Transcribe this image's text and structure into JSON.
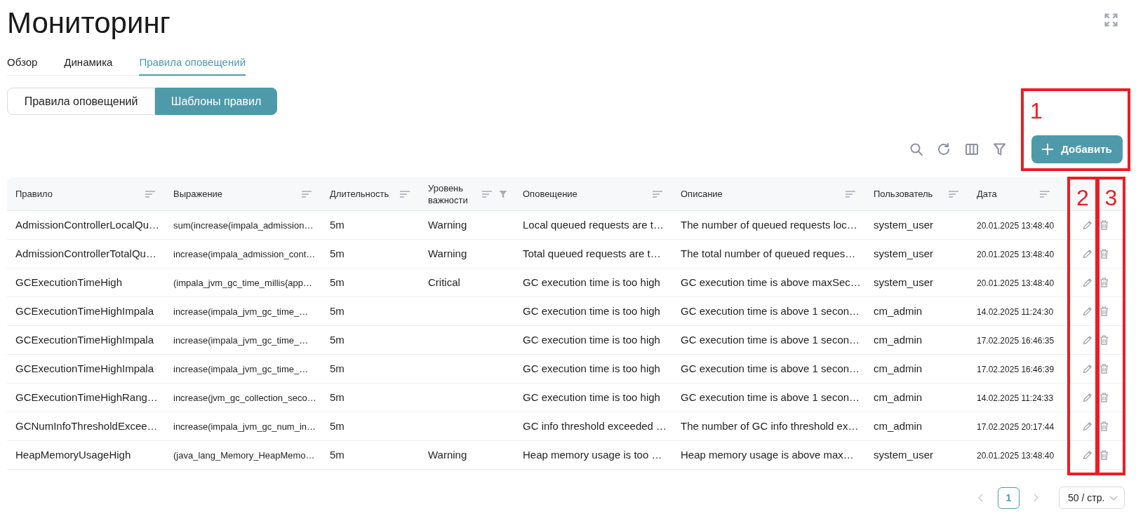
{
  "page": {
    "title": "Мониторинг"
  },
  "tabs": [
    {
      "label": "Обзор",
      "selected": false
    },
    {
      "label": "Динамика",
      "selected": false
    },
    {
      "label": "Правила оповещений",
      "selected": true
    }
  ],
  "view_switch": [
    {
      "label": "Правила оповещений",
      "selected": false
    },
    {
      "label": "Шаблоны правил",
      "selected": true
    }
  ],
  "toolbar": {
    "add_button": "Добавить"
  },
  "table": {
    "columns": [
      {
        "label": "Правило",
        "filterable": false
      },
      {
        "label": "Выражение",
        "filterable": false
      },
      {
        "label": "Длительность",
        "filterable": false
      },
      {
        "label": "Уровень важности",
        "filterable": true
      },
      {
        "label": "Оповещение",
        "filterable": false
      },
      {
        "label": "Описание",
        "filterable": false
      },
      {
        "label": "Пользователь",
        "filterable": false
      },
      {
        "label": "Дата",
        "filterable": false
      }
    ],
    "rows": [
      {
        "rule": "AdmissionControllerLocalQu…",
        "expression": "sum(increase(impala_admission…",
        "duration": "5m",
        "severity": "Warning",
        "alert": "Local queued requests are t…",
        "description": "The number of queued requests loc…",
        "user": "system_user",
        "date": "20.01.2025 13:48:40"
      },
      {
        "rule": "AdmissionControllerTotalQu…",
        "expression": "increase(impala_admission_cont…",
        "duration": "5m",
        "severity": "Warning",
        "alert": "Total queued requests are t…",
        "description": "The total number of queued reques…",
        "user": "system_user",
        "date": "20.01.2025 13:48:40"
      },
      {
        "rule": "GCExecutionTimeHigh",
        "expression": "(impala_jvm_gc_time_millis{app…",
        "duration": "5m",
        "severity": "Critical",
        "alert": "GC execution time is too high",
        "description": "GC execution time is above maxSec…",
        "user": "system_user",
        "date": "20.01.2025 13:48:40"
      },
      {
        "rule": "GCExecutionTimeHighImpala",
        "expression": "increase(impala_jvm_gc_time_…",
        "duration": "5m",
        "alert": "GC execution time is too high",
        "description": "GC execution time is above 1 secon…",
        "user": "cm_admin",
        "date": "14.02.2025 11:24:30"
      },
      {
        "rule": "GCExecutionTimeHighImpala",
        "expression": "increase(impala_jvm_gc_time_…",
        "duration": "5m",
        "alert": "GC execution time is too high",
        "description": "GC execution time is above 1 secon…",
        "user": "cm_admin",
        "date": "17.02.2025 16:46:35"
      },
      {
        "rule": "GCExecutionTimeHighImpala",
        "expression": "increase(impala_jvm_gc_time_…",
        "duration": "5m",
        "alert": "GC execution time is too high",
        "description": "GC execution time is above 1 secon…",
        "user": "cm_admin",
        "date": "17.02.2025 16:46:39"
      },
      {
        "rule": "GCExecutionTimeHighRang…",
        "expression": "increase(jvm_gc_collection_seco…",
        "duration": "5m",
        "alert": "GC execution time is too high",
        "description": "GC execution time is above 1 secon…",
        "user": "cm_admin",
        "date": "14.02.2025 11:24:33"
      },
      {
        "rule": "GCNumInfoThresholdExcee…",
        "expression": "increase(impala_jvm_gc_num_in…",
        "duration": "5m",
        "alert": "GC info threshold exceeded …",
        "description": "The number of GC info threshold ex…",
        "user": "cm_admin",
        "date": "17.02.2025 20:17:44"
      },
      {
        "rule": "HeapMemoryUsageHigh",
        "expression": "(java_lang_Memory_HeapMemo…",
        "duration": "5m",
        "severity": "Warning",
        "alert": "Heap memory usage is too …",
        "description": "Heap memory usage is above max…",
        "user": "system_user",
        "date": "20.01.2025 13:48:40"
      }
    ]
  },
  "pagination": {
    "previous_disabled": true,
    "next_disabled": true,
    "pages": [
      {
        "label": "1",
        "selected": true
      }
    ],
    "page_size": "50 / стр."
  },
  "annotations": [
    {
      "label": "1"
    },
    {
      "label": "2"
    },
    {
      "label": "3"
    }
  ]
}
